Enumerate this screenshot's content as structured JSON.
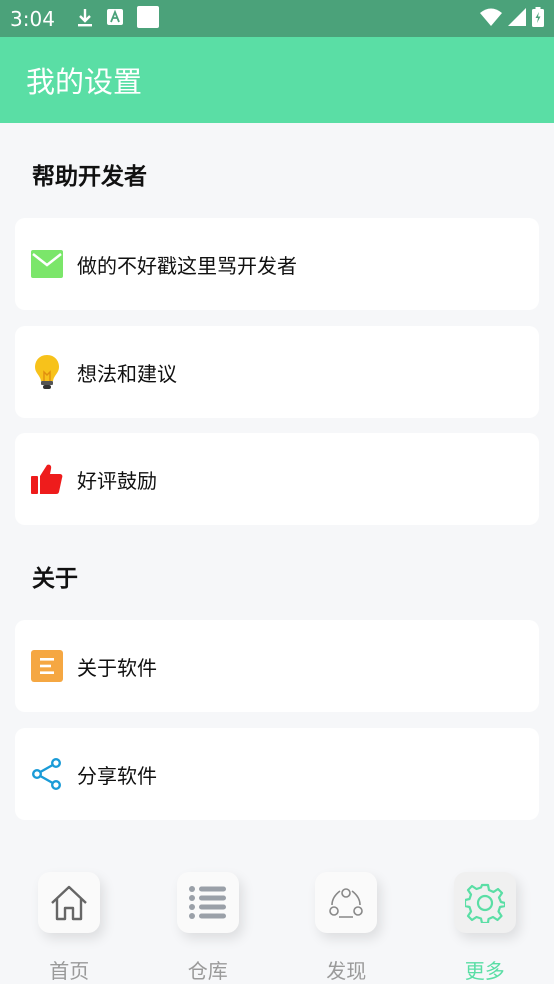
{
  "status": {
    "time": "3:04",
    "icons": [
      "download-icon",
      "a-icon",
      "square-icon",
      "wifi-icon",
      "signal-icon",
      "battery-icon"
    ]
  },
  "appbar": {
    "title": "我的设置"
  },
  "sections": {
    "help": {
      "title": "帮助开发者"
    },
    "about": {
      "title": "关于"
    }
  },
  "items": {
    "feedback": {
      "label": "做的不好戳这里骂开发者",
      "icon": "mail-icon",
      "color": "#7be66a"
    },
    "ideas": {
      "label": "想法和建议",
      "icon": "lightbulb-icon",
      "color": "#f7c21b"
    },
    "rate": {
      "label": "好评鼓励",
      "icon": "thumbs-up-icon",
      "color": "#ee1c1c"
    },
    "about_app": {
      "label": "关于软件",
      "icon": "document-icon",
      "color": "#f5a742"
    },
    "share_app": {
      "label": "分享软件",
      "icon": "share-icon",
      "color": "#1a9bd7"
    }
  },
  "nav": [
    {
      "label": "首页",
      "icon": "home-icon",
      "active": false
    },
    {
      "label": "仓库",
      "icon": "list-icon",
      "active": false
    },
    {
      "label": "发现",
      "icon": "discover-icon",
      "active": false
    },
    {
      "label": "更多",
      "icon": "gear-icon",
      "active": true
    }
  ],
  "colors": {
    "accent": "#5adea5",
    "statusbar": "#4ba27a",
    "inactive": "#9a9a9a"
  }
}
